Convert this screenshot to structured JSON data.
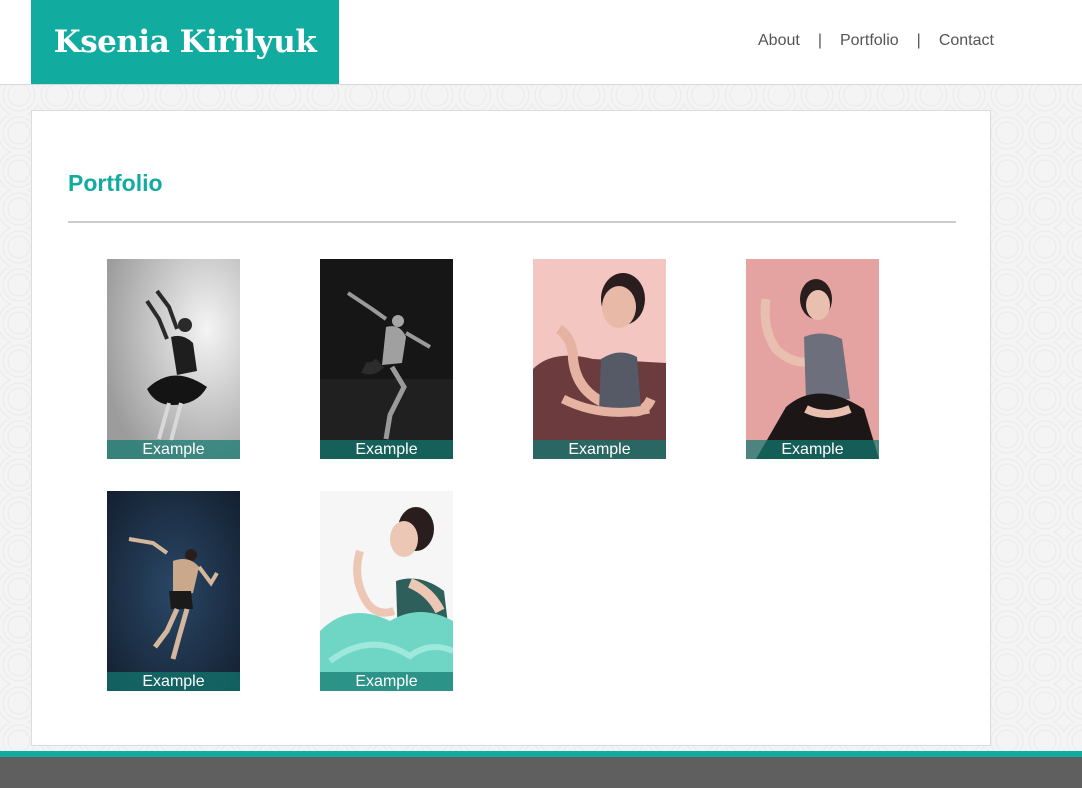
{
  "header": {
    "logo_text": "Ksenia Kirilyuk",
    "nav": {
      "about": "About",
      "portfolio": "Portfolio",
      "contact": "Contact",
      "separator": "|"
    }
  },
  "main": {
    "title": "Portfolio",
    "gallery": [
      {
        "caption": "Example",
        "photo": "ballerina-tutu-bw"
      },
      {
        "caption": "Example",
        "photo": "male-dancer-leap-bw"
      },
      {
        "caption": "Example",
        "photo": "ballerina-pink-backdrop"
      },
      {
        "caption": "Example",
        "photo": "ballerina-pink-arms-raised"
      },
      {
        "caption": "Example",
        "photo": "male-dancer-blue-backdrop"
      },
      {
        "caption": "Example",
        "photo": "ballerina-teal-tutu"
      }
    ]
  },
  "colors": {
    "accent": "#12aba0",
    "footer": "#5f5f5f",
    "nav_text": "#555555"
  }
}
